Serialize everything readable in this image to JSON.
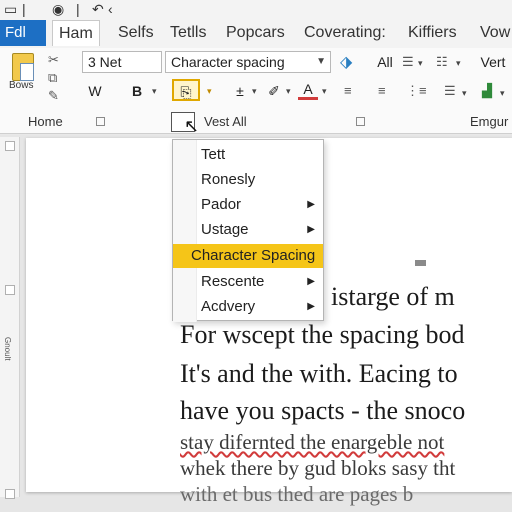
{
  "quick_access": {
    "icons": [
      "save-icon",
      "pin-icon",
      "undo-icon"
    ],
    "undo_dropdown": "‹"
  },
  "tabs": [
    {
      "label": "Fdl"
    },
    {
      "label": "Ham"
    },
    {
      "label": "Selfs"
    },
    {
      "label": "Tetlls"
    },
    {
      "label": "Popcars"
    },
    {
      "label": "Coverating:"
    },
    {
      "label": "Kiffiers"
    },
    {
      "label": "Vow"
    }
  ],
  "ribbon": {
    "paste_label": "Bows",
    "font_name": "3 Net",
    "font_style": "Character spacing",
    "bold_alt": "W",
    "bold": "B",
    "all_label": "All",
    "vert_label": "Vert",
    "group_home": "Home",
    "group_vest": "Vest All",
    "group_right": "Emgur"
  },
  "menu": {
    "items": [
      {
        "label": "Tett",
        "submenu": false
      },
      {
        "label": "Ronesly",
        "submenu": false
      },
      {
        "label": "Pador",
        "submenu": true
      },
      {
        "label": "Ustage",
        "submenu": true
      },
      {
        "label": "Character Spacing",
        "submenu": false,
        "highlighted": true
      },
      {
        "label": "Rescente",
        "submenu": true
      },
      {
        "label": "Acdvery",
        "submenu": true
      }
    ]
  },
  "document": {
    "lines": [
      "he istarge of m",
      "For wscept the spacing bod",
      "It's and the with. Eacing to",
      "have you spacts - the snoco",
      "stay difernted the enargeble not",
      "whek there by gud bloks sasy tht",
      "with et bus thed are pages b"
    ]
  },
  "ruler": {
    "label": "Gnoult"
  },
  "colors": {
    "accent": "#1d6fc4",
    "highlight": "#f5c518"
  }
}
